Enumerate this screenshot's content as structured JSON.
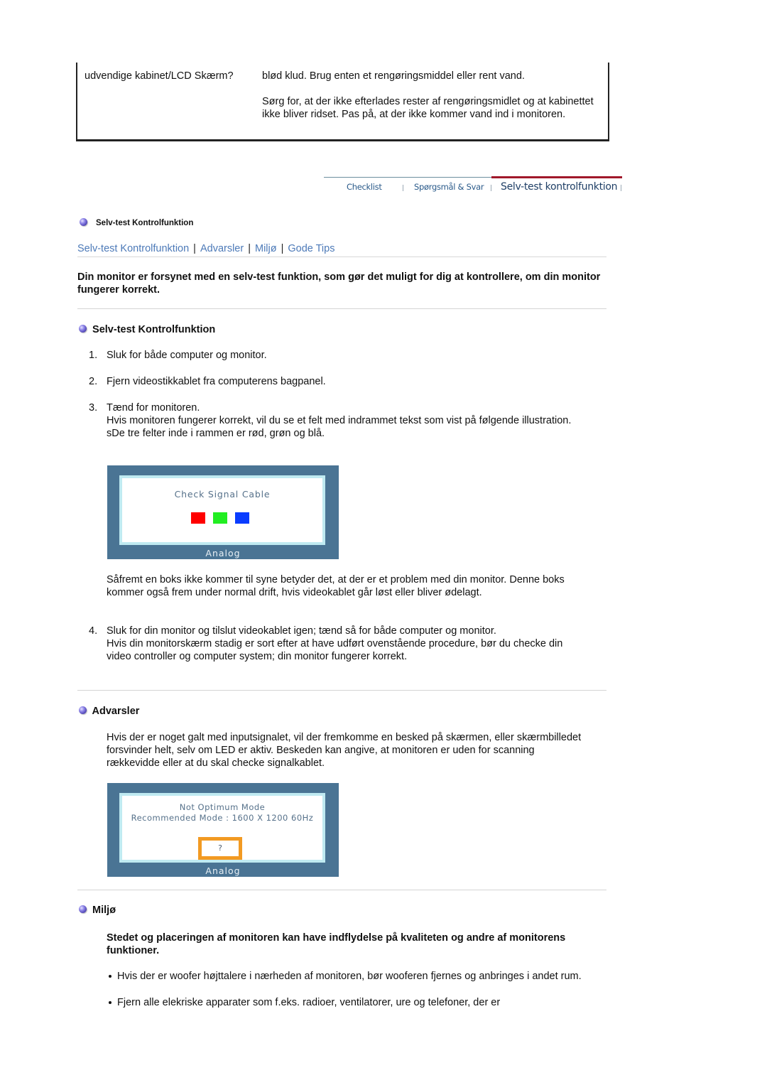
{
  "faq_fragment": {
    "question": "udvendige kabinet/LCD Skærm?",
    "answer_lines": [
      "blød klud. Brug enten et rengøringsmiddel eller rent vand.",
      "Sørg for, at der ikke efterlades rester af rengøringsmidlet og at kabinettet ikke bliver ridset. Pas på, at der ikke kommer vand ind i monitoren."
    ]
  },
  "nav_tabs": [
    {
      "label": "Checklist",
      "active": false
    },
    {
      "label": "Spørgsmål & Svar",
      "active": false
    },
    {
      "label": "Selv-test kontrolfunktion",
      "active": true
    }
  ],
  "page_heading": "Selv-test Kontrolfunktion",
  "section_links": [
    "Selv-test Kontrolfunktion",
    "Advarsler",
    "Miljø",
    "Gode Tips"
  ],
  "intro": "Din monitor er forsynet med en selv-test funktion, som gør det muligt for dig at kontrollere, om din monitor fungerer korrekt.",
  "selftest": {
    "title": "Selv-test Kontrolfunktion",
    "steps": [
      {
        "num": "1.",
        "text": "Sluk for både computer og monitor."
      },
      {
        "num": "2.",
        "text": "Fjern videostikkablet fra computerens bagpanel."
      },
      {
        "num": "3.",
        "text": "Tænd for monitoren.",
        "extra": [
          "Hvis monitoren fungerer korrekt, vil du se et felt med indrammet tekst som vist på følgende illustration.",
          "sDe tre felter inde i rammen er rød, grøn og blå."
        ]
      }
    ],
    "osd1": {
      "message": "Check Signal Cable",
      "footer": "Analog",
      "colors": [
        "#ff0000",
        "#22ee22",
        "#0a3cff"
      ]
    },
    "after_image": "Såfremt en boks ikke kommer til syne betyder det, at der er et problem med din monitor. Denne boks kommer også frem under normal drift, hvis videokablet går løst eller bliver ødelagt.",
    "step4": {
      "num": "4.",
      "text": "Sluk for din monitor og tilslut videokablet igen; tænd så for både computer og monitor.",
      "extra": "Hvis din monitorskærm stadig er sort efter at have udført ovenstående procedure, bør du checke din video controller og computer system; din monitor fungerer korrekt."
    }
  },
  "warnings": {
    "title": "Advarsler",
    "text": "Hvis der er noget galt med inputsignalet, vil der fremkomme en besked på skærmen, eller skærmbilledet forsvinder helt, selv om LED er aktiv. Beskeden kan angive, at monitoren er uden for scanning rækkevidde eller at du skal checke signalkablet.",
    "osd2": {
      "line1": "Not Optimum Mode",
      "line2": "Recommended Mode : 1600 X 1200  60Hz",
      "button": "?",
      "footer": "Analog"
    }
  },
  "environment": {
    "title": "Miljø",
    "lead": "Stedet og placeringen af monitoren kan have indflydelse på kvaliteten og andre af monitorens funktioner.",
    "bullets": [
      "Hvis der er woofer højttalere i nærheden af monitoren, bør wooferen fjernes og anbringes i andet rum.",
      "Fjern alle elekriske apparater som f.eks. radioer, ventilatorer, ure og telefoner, der er"
    ]
  }
}
